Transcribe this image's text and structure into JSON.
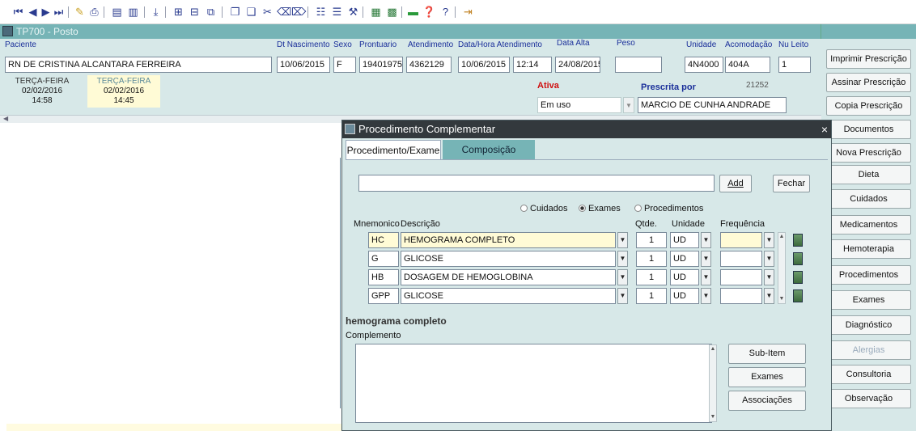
{
  "window": {
    "title": "TP700 - Posto"
  },
  "header": {
    "labels": {
      "paciente": "Paciente",
      "dt_nascimento": "Dt Nascimento",
      "sexo": "Sexo",
      "prontuario": "Prontuario",
      "atendimento": "Atendimento",
      "data_hora": "Data/Hora Atendimento",
      "data_alta": "Data Alta",
      "peso": "Peso",
      "unidade": "Unidade",
      "acomodacao": "Acomodação",
      "nu_leito": "Nu Leito",
      "ativa": "Ativa",
      "prescrita_por": "Prescrita por"
    },
    "values": {
      "paciente": "RN DE CRISTINA ALCANTARA FERREIRA",
      "dt_nascimento": "10/06/2015",
      "sexo": "F",
      "prontuario": "19401975",
      "atendimento": "4362129",
      "data_atendimento": "10/06/2015",
      "hora_atendimento": "12:14",
      "data_alta": "24/08/2015",
      "peso": "",
      "unidade": "4N4000",
      "acomodacao": "404A",
      "nu_leito": "1",
      "status": "Em uso",
      "prescrita_por": "MARCIO DE CUNHA ANDRADE",
      "prescritor_id": "21252"
    },
    "date_tabs": [
      {
        "day": "TERÇA-FEIRA",
        "date": "02/02/2016",
        "time": "14:58"
      },
      {
        "day": "TERÇA-FEIRA",
        "date": "02/02/2016",
        "time": "14:45"
      }
    ]
  },
  "sidebar": {
    "buttons": [
      "Imprimir Prescrição",
      "Assinar Prescrição",
      "Copia Prescrição",
      "Documentos",
      "Nova Prescrição",
      "Dieta",
      "Cuidados",
      "Medicamentos",
      "Hemoterapia",
      "Procedimentos",
      "Exames",
      "Diagnóstico",
      "Alergias",
      "Consultoria",
      "Observação"
    ]
  },
  "dialog": {
    "title": "Procedimento Complementar",
    "close_glyph": "×",
    "tabs": [
      "Procedimento/Exame",
      "Composição"
    ],
    "search_value": "",
    "add_label": "Add",
    "close_label": "Fechar",
    "radios": [
      {
        "label": "Cuidados",
        "checked": false
      },
      {
        "label": "Exames",
        "checked": true
      },
      {
        "label": "Procedimentos",
        "checked": false
      }
    ],
    "columns": {
      "mnemonico": "Mnemonico",
      "descricao": "Descrição",
      "qtde": "Qtde.",
      "unidade": "Unidade",
      "frequencia": "Frequência"
    },
    "rows": [
      {
        "mnemonico": "HC",
        "descricao": "HEMOGRAMA COMPLETO",
        "qtde": "1",
        "unidade": "UD",
        "frequencia": ""
      },
      {
        "mnemonico": "G",
        "descricao": "GLICOSE",
        "qtde": "1",
        "unidade": "UD",
        "frequencia": ""
      },
      {
        "mnemonico": "HB",
        "descricao": "DOSAGEM DE HEMOGLOBINA",
        "qtde": "1",
        "unidade": "UD",
        "frequencia": ""
      },
      {
        "mnemonico": "GPP",
        "descricao": "GLICOSE",
        "qtde": "1",
        "unidade": "UD",
        "frequencia": ""
      }
    ],
    "selected_description": "hemograma completo",
    "complemento_label": "Complemento",
    "complemento_value": "",
    "buttons": {
      "subitem": "Sub-Item",
      "exames": "Exames",
      "associacoes": "Associações"
    }
  },
  "colors": {
    "titlebar": "#76b4b6",
    "panel": "#d7e8e8",
    "dialog_title": "#33393d",
    "label_blue": "#1a2f9a",
    "ativa_red": "#d01010",
    "selected_row": "#fffbd6"
  }
}
